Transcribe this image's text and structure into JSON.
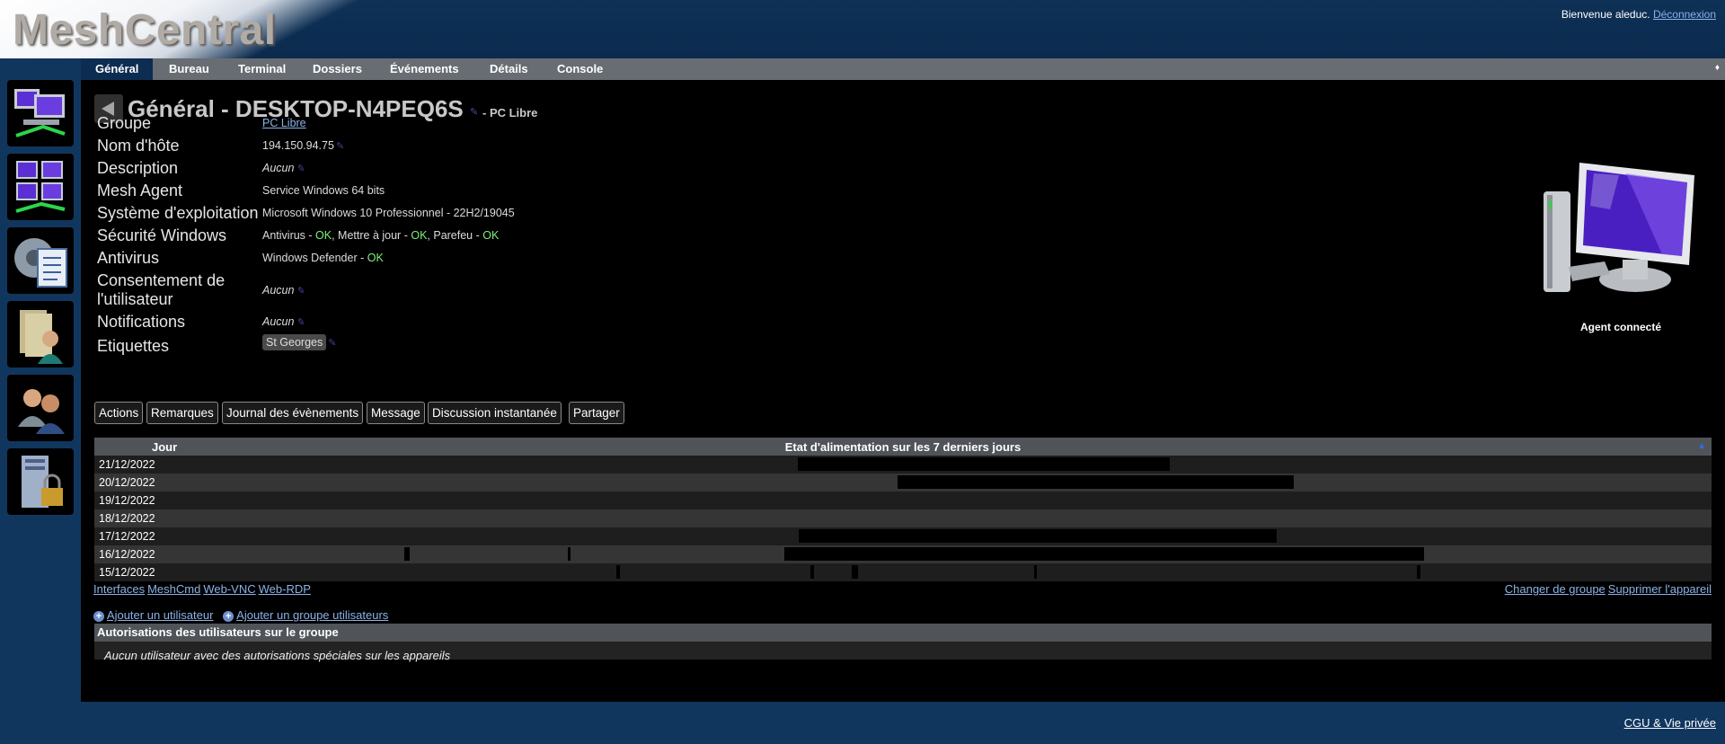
{
  "app": {
    "title": "MeshCentral"
  },
  "header": {
    "welcome": "Bienvenue aleduc.",
    "logout": "Déconnexion"
  },
  "tabs": [
    "Général",
    "Bureau",
    "Terminal",
    "Dossiers",
    "Événements",
    "Détails",
    "Console"
  ],
  "sidebar_icons": [
    "my-devices-icon",
    "device-groups-icon",
    "my-server-icon",
    "my-files-icon",
    "my-users-icon",
    "server-security-icon"
  ],
  "device": {
    "title": "Général - DESKTOP-N4PEQ6S",
    "group_suffix": "- PC Libre",
    "status": "Agent connecté"
  },
  "properties": {
    "groupe": {
      "label": "Groupe",
      "value": "PC Libre"
    },
    "hostname": {
      "label": "Nom d'hôte",
      "value": "194.150.94.75"
    },
    "description": {
      "label": "Description",
      "value": "Aucun"
    },
    "agent": {
      "label": "Mesh Agent",
      "value": "Service Windows 64 bits"
    },
    "os": {
      "label": "Système d'exploitation",
      "value": "Microsoft Windows 10 Professionnel - 22H2/19045"
    },
    "security": {
      "label": "Sécurité Windows",
      "antivirus": "Antivirus - ",
      "antivirus_ok": "OK",
      "update": ", Mettre à jour - ",
      "update_ok": "OK",
      "firewall": ", Parefeu - ",
      "firewall_ok": "OK"
    },
    "antivirus": {
      "label": "Antivirus",
      "value": "Windows Defender - ",
      "ok": "OK"
    },
    "consent": {
      "label_line1": "Consentement de",
      "label_line2": "l'utilisateur",
      "value": "Aucun"
    },
    "notifications": {
      "label": "Notifications",
      "value": "Aucun"
    },
    "tags": {
      "label": "Etiquettes",
      "value": "St Georges"
    }
  },
  "action_buttons": [
    "Actions",
    "Remarques",
    "Journal des évènements",
    "Message",
    "Discussion instantanée",
    "Partager"
  ],
  "power_table": {
    "header_day": "Jour",
    "header_state": "Etat d'alimentation sur les 7 derniers jours",
    "rows": [
      {
        "date": "21/12/2022",
        "segments": [
          [
            0.4348,
            0.665
          ]
        ]
      },
      {
        "date": "20/12/2022",
        "segments": [
          [
            0.4967,
            0.7415
          ]
        ]
      },
      {
        "date": "19/12/2022",
        "segments": []
      },
      {
        "date": "18/12/2022",
        "segments": []
      },
      {
        "date": "17/12/2022",
        "segments": [
          [
            0.4356,
            0.7312
          ]
        ]
      },
      {
        "date": "16/12/2022",
        "segments": [
          [
            0.1916,
            0.195
          ],
          [
            0.2925,
            0.2945
          ],
          [
            0.4265,
            0.8225
          ]
        ]
      },
      {
        "date": "15/12/2022",
        "segments": [
          [
            0.323,
            0.325
          ],
          [
            0.443,
            0.445
          ],
          [
            0.4685,
            0.4725
          ],
          [
            0.581,
            0.583
          ],
          [
            0.8175,
            0.82
          ]
        ]
      }
    ]
  },
  "links_left": [
    "Interfaces",
    "MeshCmd",
    "Web-VNC",
    "Web-RDP"
  ],
  "links_right": [
    "Changer de groupe",
    "Supprimer l'appareil"
  ],
  "users": {
    "add_user": "Ajouter un utilisateur",
    "add_group": "Ajouter un groupe utilisateurs",
    "section_title": "Autorisations des utilisateurs sur le groupe",
    "empty": "Aucun utilisateur avec des autorisations spéciales sur les appareils"
  },
  "footer": {
    "link": "CGU & Vie privée"
  },
  "colors": {
    "ok": "#7cf17c",
    "link": "#8ab2e8",
    "accent": "#0d2c52"
  }
}
